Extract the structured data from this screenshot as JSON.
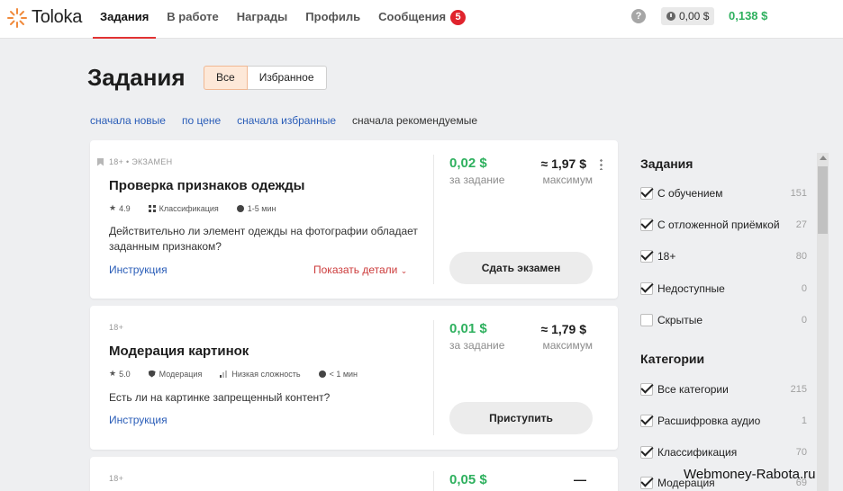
{
  "header": {
    "logo_text": "Toloka",
    "nav": [
      {
        "label": "Задания",
        "active": true
      },
      {
        "label": "В работе",
        "active": false
      },
      {
        "label": "Награды",
        "active": false
      },
      {
        "label": "Профиль",
        "active": false
      },
      {
        "label": "Сообщения",
        "active": false
      }
    ],
    "messages_badge": "5",
    "help_icon": "?",
    "pending_balance": "0,00 $",
    "balance": "0,138 $",
    "accent_color": "#e13333",
    "money_color": "#2eb05e"
  },
  "page": {
    "title": "Задания",
    "filters": {
      "all": "Все",
      "favorites": "Избранное"
    },
    "sorts": [
      "сначала новые",
      "по цене",
      "сначала избранные",
      "сначала рекомендуемые"
    ]
  },
  "cards": [
    {
      "meta": "18+ • ЭКЗАМЕН",
      "title": "Проверка признаков одежды",
      "rating": "4.9",
      "tag1": "Классификация",
      "duration": "1-5 мин",
      "description": "Действительно ли элемент одежды на фотографии обладает заданным признаком?",
      "instruction": "Инструкция",
      "details": "Показать детали",
      "price": "0,02 $",
      "price_sub": "за задание",
      "max": "≈ 1,97 $",
      "max_sub": "максимум",
      "action": "Сдать экзамен"
    },
    {
      "meta": "18+",
      "title": "Модерация картинок",
      "rating": "5.0",
      "tag1": "Модерация",
      "tag2": "Низкая сложность",
      "duration": "< 1 мин",
      "description": "Есть ли на картинке запрещенный контент?",
      "instruction": "Инструкция",
      "price": "0,01 $",
      "price_sub": "за задание",
      "max": "≈ 1,79 $",
      "max_sub": "максимум",
      "action": "Приступить"
    },
    {
      "meta": "18+",
      "price": "0,05 $",
      "max": "—"
    }
  ],
  "sidebar": {
    "tasks_title": "Задания",
    "tasks": [
      {
        "label": "С обучением",
        "count": "151",
        "checked": true
      },
      {
        "label": "С отложенной приёмкой",
        "count": "27",
        "checked": true
      },
      {
        "label": "18+",
        "count": "80",
        "checked": true
      },
      {
        "label": "Недоступные",
        "count": "0",
        "checked": true
      },
      {
        "label": "Скрытые",
        "count": "0",
        "checked": false
      }
    ],
    "categories_title": "Категории",
    "categories": [
      {
        "label": "Все категории",
        "count": "215",
        "checked": true
      },
      {
        "label": "Расшифровка аудио",
        "count": "1",
        "checked": true
      },
      {
        "label": "Классификация",
        "count": "70",
        "checked": true
      },
      {
        "label": "Модерация",
        "count": "69",
        "checked": true
      }
    ]
  },
  "watermark": "Webmoney-Rabota.ru"
}
